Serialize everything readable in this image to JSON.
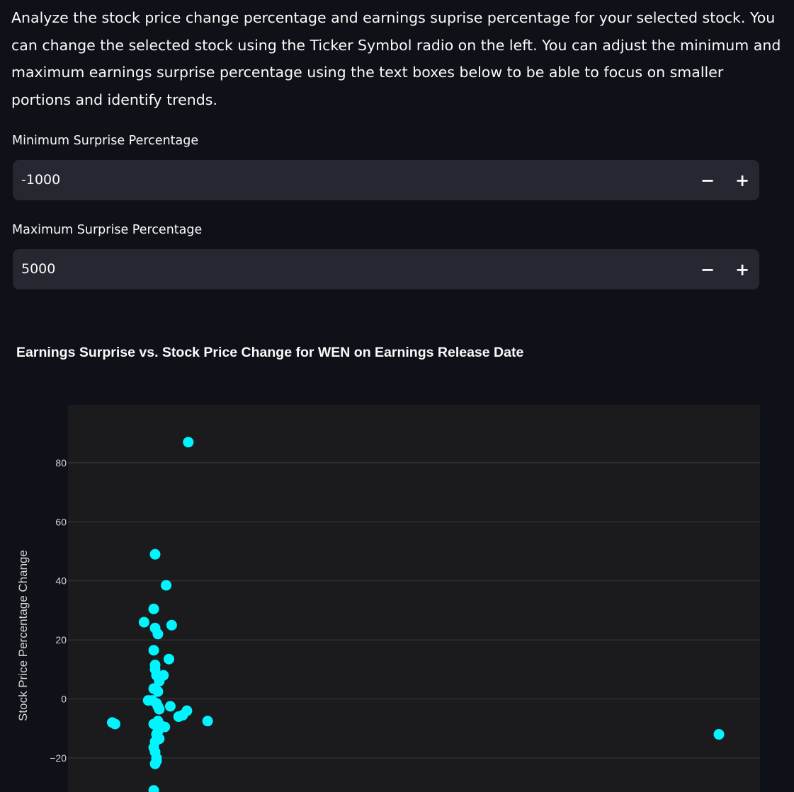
{
  "description": "Analyze the stock price change percentage and earnings suprise percentage for your selected stock. You can change the selected stock using the Ticker Symbol radio on the left. You can adjust the minimum and maximum earnings surprise percentage using the text boxes below to be able to focus on smaller portions and identify trends.",
  "min_input": {
    "label": "Minimum Surprise Percentage",
    "value": "-1000",
    "minus": "−",
    "plus": "+"
  },
  "max_input": {
    "label": "Maximum Surprise Percentage",
    "value": "5000",
    "minus": "−",
    "plus": "+"
  },
  "chart_title": "Earnings Surprise vs. Stock Price Change for WEN on Earnings Release Date",
  "colors": {
    "background": "#0e1117",
    "input_bg": "#262730",
    "plot_bg": "#1b1b1d",
    "gridline": "#3a3a3e",
    "marker": "#00f5ff"
  },
  "chart_data": {
    "type": "scatter",
    "title": "Earnings Surprise vs. Stock Price Change for WEN on Earnings Release Date",
    "xlabel": "",
    "ylabel": "Stock Price Percentage Change",
    "y_ticks": [
      "80",
      "60",
      "40",
      "20",
      "0",
      "−20"
    ],
    "grid": true,
    "points": [
      {
        "x": -142,
        "y": 87
      },
      {
        "x": -154,
        "y": 49
      },
      {
        "x": -150,
        "y": 38.5
      },
      {
        "x": -154.5,
        "y": 30.5
      },
      {
        "x": -158,
        "y": 26
      },
      {
        "x": -154,
        "y": 24
      },
      {
        "x": -148,
        "y": 25
      },
      {
        "x": -153,
        "y": 22
      },
      {
        "x": -154.5,
        "y": 16.5
      },
      {
        "x": -149,
        "y": 13.5
      },
      {
        "x": -154,
        "y": 11.5
      },
      {
        "x": -154,
        "y": 10
      },
      {
        "x": -153.5,
        "y": 8
      },
      {
        "x": -152,
        "y": 7.5
      },
      {
        "x": -151,
        "y": 8
      },
      {
        "x": -152.5,
        "y": 6
      },
      {
        "x": -154.5,
        "y": 3.5
      },
      {
        "x": -153,
        "y": 2.5
      },
      {
        "x": -156.5,
        "y": -0.5
      },
      {
        "x": -155,
        "y": -0.5
      },
      {
        "x": -153.5,
        "y": -1.5
      },
      {
        "x": -153,
        "y": -2.5
      },
      {
        "x": -148.5,
        "y": -2.5
      },
      {
        "x": -152.5,
        "y": -3.5
      },
      {
        "x": -142.5,
        "y": -4
      },
      {
        "x": -144,
        "y": -5.5
      },
      {
        "x": -145.5,
        "y": -6
      },
      {
        "x": -153,
        "y": -7.5
      },
      {
        "x": -154.5,
        "y": -8.5
      },
      {
        "x": -153.5,
        "y": -9
      },
      {
        "x": -152,
        "y": -9
      },
      {
        "x": -150.5,
        "y": -9.5
      },
      {
        "x": -153,
        "y": -11
      },
      {
        "x": -153.5,
        "y": -12
      },
      {
        "x": -152.5,
        "y": -13.5
      },
      {
        "x": -154,
        "y": -14.5
      },
      {
        "x": -154.5,
        "y": -16.5
      },
      {
        "x": -154,
        "y": -18
      },
      {
        "x": -153.5,
        "y": -20
      },
      {
        "x": -153.5,
        "y": -21
      },
      {
        "x": -154,
        "y": -22
      },
      {
        "x": -169.5,
        "y": -8
      },
      {
        "x": -168.5,
        "y": -8.5
      },
      {
        "x": -135,
        "y": -7.5
      },
      {
        "x": -154.5,
        "y": -31
      },
      {
        "x": 50,
        "y": -12
      }
    ]
  }
}
